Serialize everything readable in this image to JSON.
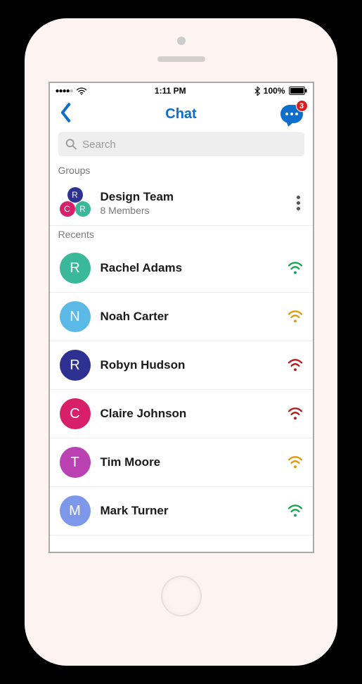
{
  "status": {
    "time": "1:11 PM",
    "battery_pct": "100%"
  },
  "nav": {
    "title": "Chat",
    "notification_count": "3"
  },
  "search": {
    "placeholder": "Search"
  },
  "sections": {
    "groups_label": "Groups",
    "recents_label": "Recents"
  },
  "groups": [
    {
      "name": "Design Team",
      "subtitle": "8 Members"
    }
  ],
  "recents": [
    {
      "initial": "R",
      "name": "Rachel Adams",
      "avatar_color": "c-teal",
      "wifi_color": "w-green"
    },
    {
      "initial": "N",
      "name": "Noah Carter",
      "avatar_color": "c-sky",
      "wifi_color": "w-amber"
    },
    {
      "initial": "R",
      "name": "Robyn Hudson",
      "avatar_color": "c-navy",
      "wifi_color": "w-red"
    },
    {
      "initial": "C",
      "name": "Claire Johnson",
      "avatar_color": "c-pink",
      "wifi_color": "w-red"
    },
    {
      "initial": "T",
      "name": "Tim Moore",
      "avatar_color": "c-purple",
      "wifi_color": "w-amber"
    },
    {
      "initial": "M",
      "name": "Mark Turner",
      "avatar_color": "c-periwinkle",
      "wifi_color": "w-green"
    }
  ]
}
